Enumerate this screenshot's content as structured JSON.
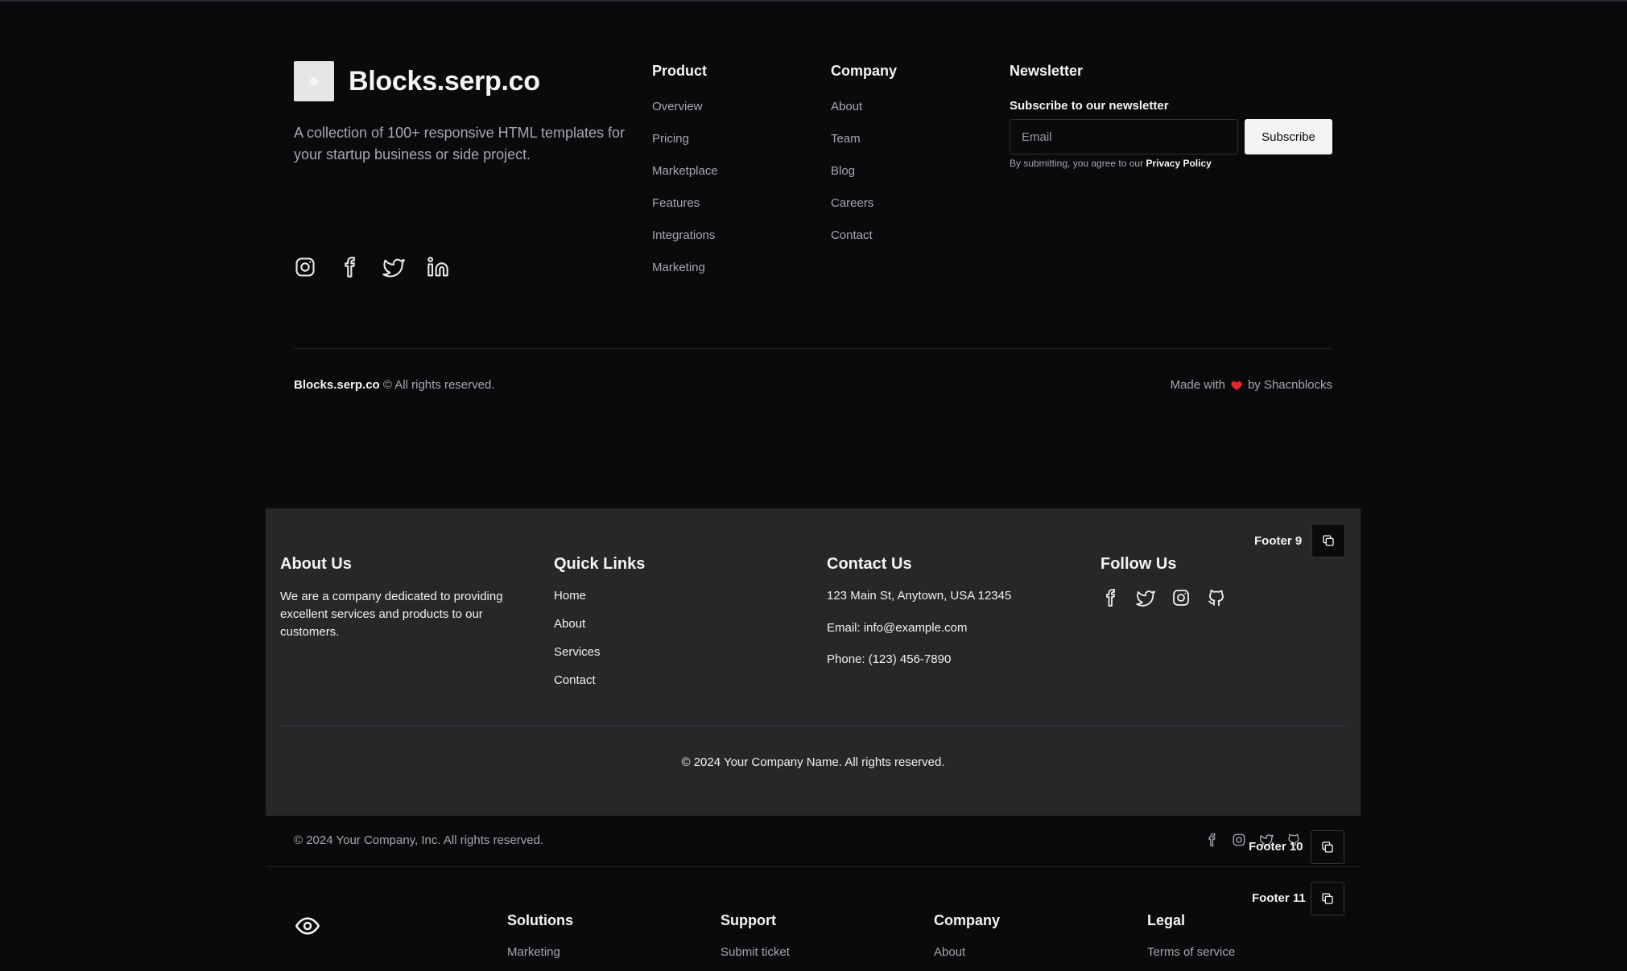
{
  "footer8": {
    "brand": "Blocks.serp.co",
    "description": "A collection of 100+ responsive HTML templates for your startup business or side project.",
    "social_icons": [
      "instagram-icon",
      "facebook-icon",
      "twitter-icon",
      "linkedin-icon"
    ],
    "product": {
      "title": "Product",
      "items": [
        "Overview",
        "Pricing",
        "Marketplace",
        "Features",
        "Integrations",
        "Marketing"
      ]
    },
    "company": {
      "title": "Company",
      "items": [
        "About",
        "Team",
        "Blog",
        "Careers",
        "Contact"
      ]
    },
    "newsletter": {
      "title": "Newsletter",
      "subtitle": "Subscribe to our newsletter",
      "email_placeholder": "Email",
      "button": "Subscribe",
      "note": "By submitting, you agree to our",
      "policy": "Privacy Policy"
    },
    "copyright_brand": "Blocks.serp.co",
    "copyright_text": "© All rights reserved.",
    "made_with": "Made with",
    "made_by": "by Shacnblocks",
    "heart_color": "#e5242f"
  },
  "footer9": {
    "tag": "Footer 9",
    "about": {
      "title": "About Us",
      "text": "We are a company dedicated to providing excellent services and products to our customers."
    },
    "quick_links": {
      "title": "Quick Links",
      "items": [
        "Home",
        "About",
        "Services",
        "Contact"
      ]
    },
    "contact": {
      "title": "Contact Us",
      "address": "123 Main St, Anytown, USA 12345",
      "email": "Email: info@example.com",
      "phone": "Phone: (123) 456-7890"
    },
    "follow": {
      "title": "Follow Us",
      "icons": [
        "facebook-icon",
        "twitter-icon",
        "instagram-icon",
        "github-icon"
      ]
    },
    "copyright": "© 2024 Your Company Name. All rights reserved.",
    "background": "#27272a"
  },
  "footer10": {
    "tag": "Footer 10",
    "copyright": "© 2024 Your Company, Inc. All rights reserved."
  },
  "footer11": {
    "tag": "Footer 11",
    "columns": [
      {
        "title": "Solutions",
        "first": "Marketing"
      },
      {
        "title": "Support",
        "first": "Submit ticket"
      },
      {
        "title": "Company",
        "first": "About"
      },
      {
        "title": "Legal",
        "first": "Terms of service"
      }
    ]
  }
}
